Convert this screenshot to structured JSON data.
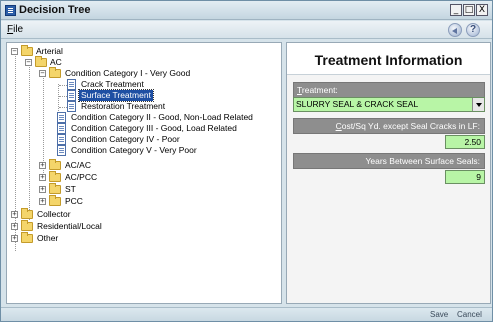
{
  "window": {
    "title": "Decision Tree",
    "controls": {
      "minimize": "_",
      "maximize": "□",
      "close": "X"
    }
  },
  "menu": {
    "file_first": "F",
    "file_rest": "ile"
  },
  "icons": {
    "back": "back-arrow-icon",
    "help": "?"
  },
  "tree": {
    "arterial": "Arterial",
    "ac": "AC",
    "cat1": "Condition Category I - Very Good",
    "crack": "Crack Treatment",
    "surface": "Surface Treatment",
    "restoration": "Restoration Treatment",
    "cat2": "Condition Category II - Good, Non-Load Related",
    "cat3": "Condition Category III - Good, Load Related",
    "cat4": "Condition Category IV - Poor",
    "cat5": "Condition Category V - Very Poor",
    "acac": "AC/AC",
    "acpcc": "AC/PCC",
    "st": "ST",
    "pcc": "PCC",
    "collector": "Collector",
    "residential": "Residential/Local",
    "other": "Other",
    "expand_plus": "+",
    "expand_minus": "−"
  },
  "panel": {
    "title": "Treatment Information",
    "treatment_label_first": "T",
    "treatment_label_rest": "reatment:",
    "treatment_value": "SLURRY SEAL & CRACK SEAL",
    "cost_label_first": "C",
    "cost_label_rest": "ost/Sq Yd. except Seal Cracks in LF:",
    "cost_value": "2.50",
    "years_label": "Years Between Surface Seals:",
    "years_value": "9"
  },
  "bottom": {
    "save": "Save",
    "cancel": "Cancel"
  },
  "colors": {
    "selection": "#1e4fa3",
    "field_green": "#b8f5a6",
    "header_gray": "#8e8e8e"
  }
}
